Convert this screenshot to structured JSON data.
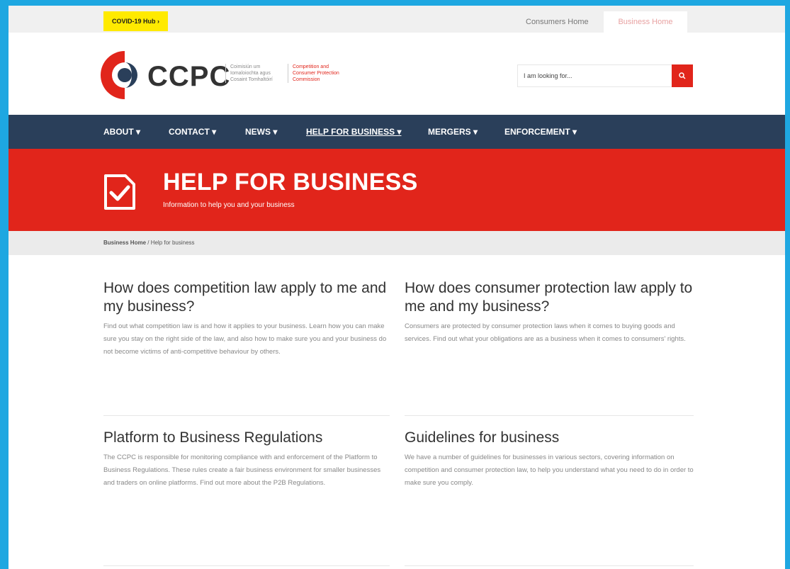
{
  "topbar": {
    "covid_hub": "COVID-19 Hub ›",
    "consumers_home": "Consumers Home",
    "business_home": "Business Home"
  },
  "logo": {
    "name": "CCPC",
    "irish_name": "Coimisiún um Iomaloiochta agus Cosaint Tomhaltóirí",
    "english_name": "Competition and Consumer Protection Commission"
  },
  "search": {
    "placeholder": "I am looking for..."
  },
  "nav": {
    "items": [
      {
        "label": "ABOUT ▾"
      },
      {
        "label": "CONTACT ▾"
      },
      {
        "label": "NEWS ▾"
      },
      {
        "label": "HELP FOR BUSINESS ▾"
      },
      {
        "label": "MERGERS ▾"
      },
      {
        "label": "ENFORCEMENT ▾"
      }
    ]
  },
  "hero": {
    "title": "HELP FOR BUSINESS",
    "subtitle": "Information to help you and your business"
  },
  "breadcrumb": {
    "home": "Business Home",
    "separator": " / ",
    "current": "Help for business"
  },
  "cards": [
    {
      "title": "How does competition law apply to me and my business?",
      "body": "Find out what competition law is and how it applies to your business. Learn how you can make sure you stay on the right side of the law, and also how to make sure you and your business do not become victims of anti-competitive behaviour by others."
    },
    {
      "title": "How does consumer protection law apply to me and my business?",
      "body": "Consumers are protected by consumer protection laws when it comes to buying goods and services. Find out what your obligations are as a business when it comes to consumers' rights."
    },
    {
      "title": "Platform to Business Regulations",
      "body": "The CCPC is responsible for monitoring compliance with and enforcement of the Platform to Business Regulations. These rules create a fair business environment for smaller businesses and traders on online platforms. Find out more about the P2B Regulations."
    },
    {
      "title": "Guidelines for business",
      "body": "We have a number of guidelines for businesses in various sectors, covering information on competition and consumer protection law, to help you understand what you need to do in order to make sure you comply."
    }
  ],
  "colors": {
    "accent_red": "#e1251b",
    "nav_navy": "#2a3f5a",
    "covid_yellow": "#ffea00",
    "frame_blue": "#1ea7e1"
  }
}
